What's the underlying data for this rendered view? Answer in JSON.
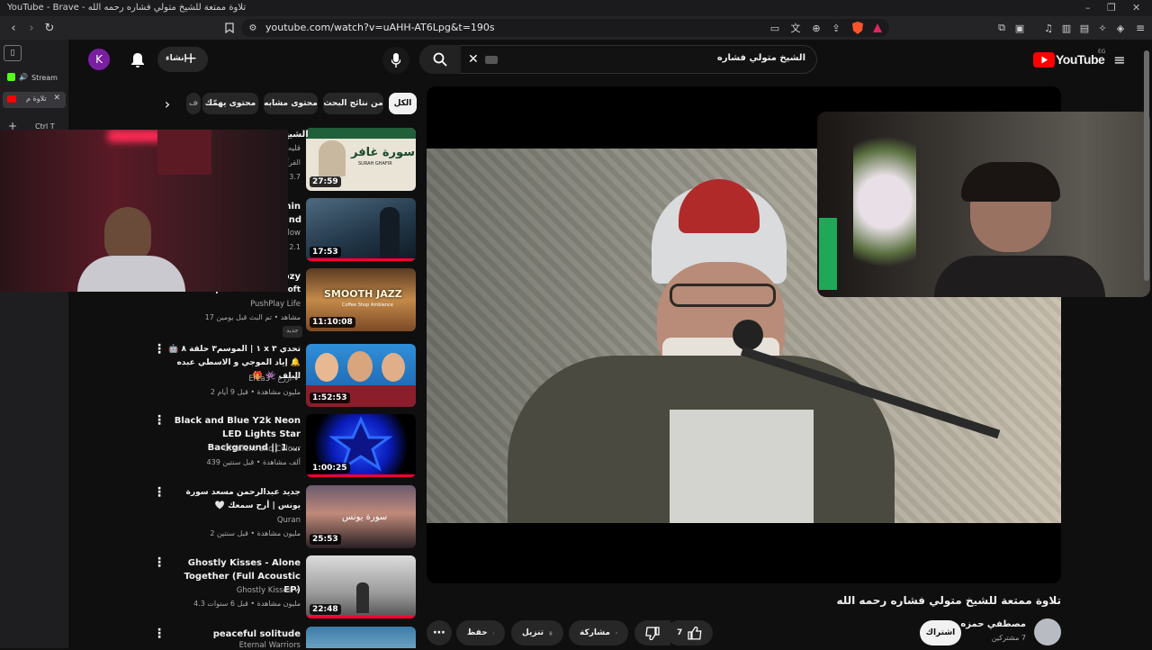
{
  "window": {
    "title": "YouTube - Brave - تلاوة ممتعة للشيخ متولي فشاره رحمه الله"
  },
  "browser": {
    "url": "youtube.com/watch?v=uAHH-AT6Lpg&t=190s"
  },
  "tabs": [
    {
      "label": "Stream",
      "active": false
    },
    {
      "label": "تلاوة م",
      "active": true
    },
    {
      "label": "Ctrl T",
      "active": false
    }
  ],
  "header": {
    "logo_text": "YouTube",
    "region": "EG",
    "search_value": "الشيخ متولي فشاره",
    "create_label": "إنشاء",
    "avatar_letter": "K"
  },
  "chips": [
    {
      "label": "الكل",
      "active": true
    },
    {
      "label": "من نتائج البحث",
      "active": false
    },
    {
      "label": "محتوى مشابه",
      "active": false
    },
    {
      "label": "محتوى يهمّك",
      "active": false
    },
    {
      "label": "ف",
      "active": false
    }
  ],
  "related": [
    {
      "title": "الشيخ",
      "subtitle": "قليه",
      "channel": "القرآ",
      "meta": "3.7",
      "duration": "27:59",
      "thumb_text": "سورة غافر",
      "thumb_label": "SURAH GHAFIR"
    },
    {
      "title": "nin",
      "subtitle": "and",
      "channel": "llow",
      "meta": "2.1",
      "duration": "17:53"
    },
    {
      "title": "ozy",
      "subtitle": "Coffee Shop Ambience ☕ Soft",
      "channel": "PushPlay Life",
      "meta": "17 مشاهد • تم البث قبل يومين",
      "badge": "جديد",
      "duration": "11:10:08",
      "thumb_text": "SMOOTH JAZZ",
      "thumb_label": "Coffee Shop Ambience"
    },
    {
      "title": "تحدي ٣ x ١ | الموسم٣ حلقة ٨ 🤖 🔔 إياد الموجي و الاسطي عبده البلف 👾 🎁",
      "channel": "Erza3 - ازرع ✔",
      "meta": "2 مليون مشاهدة • قبل 9 أيام",
      "duration": "1:52:53"
    },
    {
      "title": "Black and Blue Y2k Neon LED Lights Star Background || 1 ...",
      "channel": "Gradient and Colour",
      "meta": "439 ألف مشاهدة • قبل سنتين",
      "duration": "1:00:25"
    },
    {
      "title": "جديد عبدالرحمن مسعد سورة يونس | أرح سمعك 🤍",
      "channel": "Quran",
      "meta": "2 مليون مشاهدة • قبل سنتين",
      "duration": "25:53",
      "thumb_text": "سورة يونس"
    },
    {
      "title": "Ghostly Kisses - Alone Together (Full Acoustic EP)",
      "channel": "Ghostly Kisses ✔",
      "meta": "4.3 مليون مشاهدة • قبل 6 سنوات",
      "duration": "22:48"
    },
    {
      "title": "peaceful solitude",
      "channel": "Eternal Warriors",
      "meta": "",
      "duration": ""
    }
  ],
  "video": {
    "title": "تلاوة ممتعة للشيخ متولي فشاره رحمه الله",
    "channel": "مصطفي حمزه",
    "subscribers": "7 مشتركين",
    "subscribe_label": "اشتراك",
    "likes": "7",
    "share_label": "مشاركة",
    "download_label": "تنزيل",
    "save_label": "حفظ"
  },
  "colors": {
    "background": "#0f0f0f",
    "chip": "#272727",
    "youtube_red": "#ff0000",
    "progress_red": "#ff0033"
  }
}
